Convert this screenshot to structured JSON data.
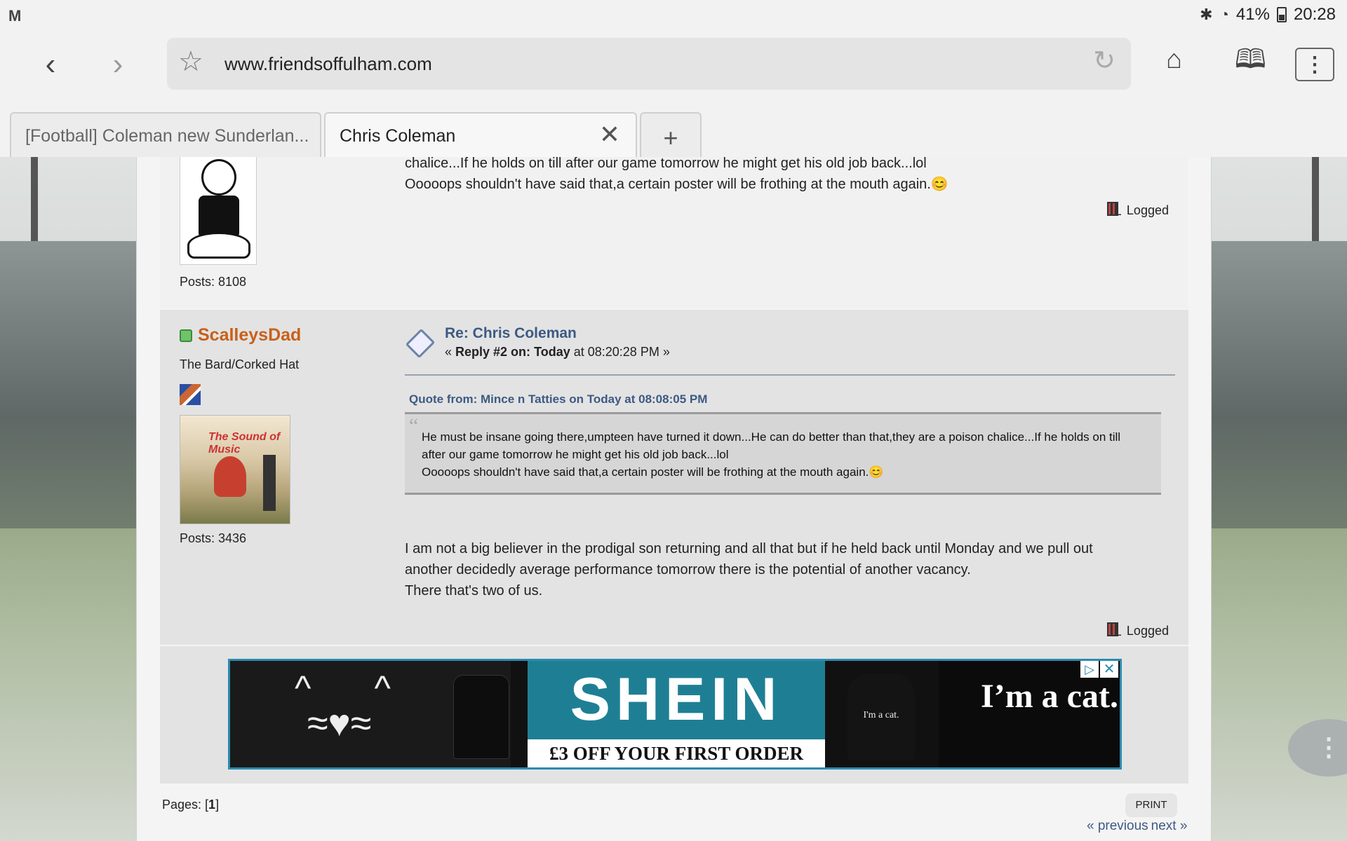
{
  "statusbar": {
    "app_icon": "M",
    "battery": "41%",
    "time": "20:28"
  },
  "browser": {
    "url": "www.friendsoffulham.com",
    "tabs": [
      {
        "label": "[Football] Coleman new Sunderlan...",
        "active": false
      },
      {
        "label": "Chris Coleman",
        "active": true
      }
    ],
    "new_tab": "+"
  },
  "posts": [
    {
      "posts_count": "Posts: 8108",
      "message_lines": [
        "chalice...If he holds on till after our game tomorrow he might get his old job back...lol",
        "Ooooops shouldn't have said that,a certain poster will be frothing at the mouth again.😊"
      ],
      "logged": "Logged"
    },
    {
      "username": "ScalleysDad",
      "user_title": "The Bard/Corked Hat",
      "avatar_text": "The Sound of Music",
      "posts_count": "Posts: 3436",
      "subject": "Re: Chris Coleman",
      "meta_prefix": "« ",
      "meta_reply": "Reply #2 on:",
      "meta_today": "Today",
      "meta_time": " at 08:20:28 PM »",
      "quote_header": "Quote from: Mince n Tatties on Today at 08:08:05 PM",
      "quote_lines": [
        "He must be insane going there,umpteen have turned it down...He can do better than that,they are a poison chalice...If he holds on till",
        "after our game tomorrow he might get his old job back...lol",
        "Ooooops shouldn't have said that,a certain poster will be frothing at the mouth again.😊"
      ],
      "message_lines": [
        "I am not a big believer in the prodigal son returning and all that but if he held back until Monday and we pull out",
        "another decidedly average performance tomorrow there is the potential of another vacancy.",
        "There that's two of us."
      ],
      "logged": "Logged"
    }
  ],
  "ad": {
    "brand": "SHEIN",
    "offer": "£3 OFF YOUR FIRST ORDER",
    "tagline": "I’m a cat.",
    "hoodie_text": "I'm a cat."
  },
  "footer": {
    "pages_label": "Pages: [",
    "pages_current": "1",
    "pages_end": "]",
    "print": "PRINT",
    "previous": "« previous",
    "next": "next »"
  },
  "colors": {
    "accent_link": "#3d5a83",
    "username": "#c8601a",
    "ad_teal": "#1e7f94"
  }
}
